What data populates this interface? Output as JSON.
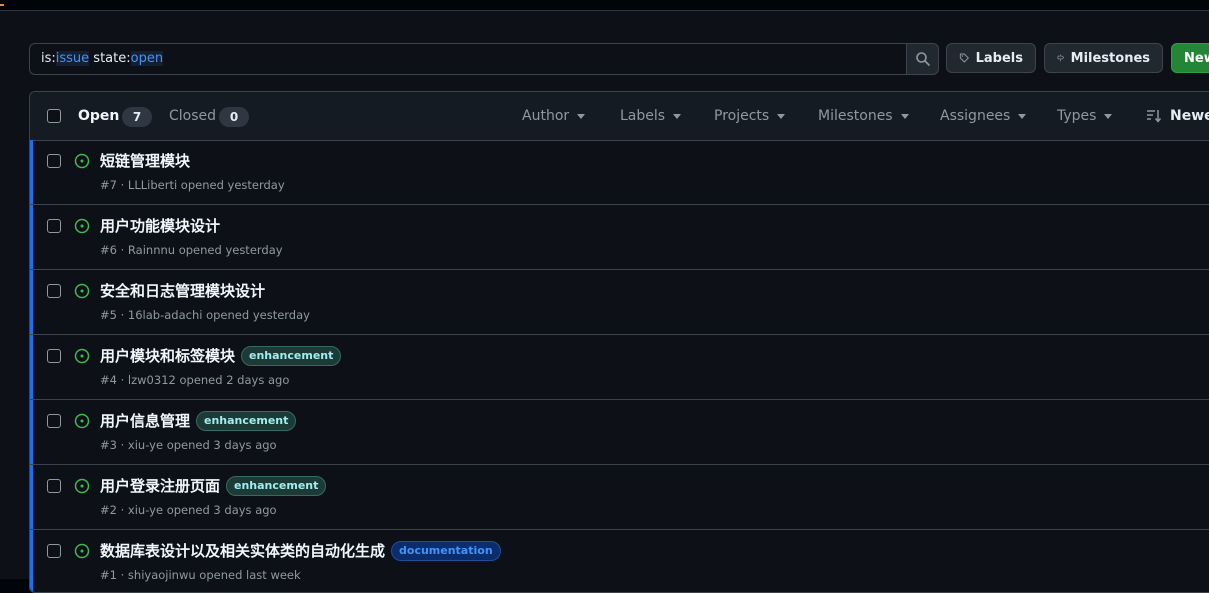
{
  "search": {
    "prefix_is": "is:",
    "value_is": "issue",
    "prefix_state": " state:",
    "value_state": "open"
  },
  "buttons": {
    "labels": "Labels",
    "milestones": "Milestones",
    "new": "New"
  },
  "tabs": {
    "open_label": "Open",
    "open_count": "7",
    "closed_label": "Closed",
    "closed_count": "0"
  },
  "filters": {
    "author": "Author",
    "labels": "Labels",
    "projects": "Projects",
    "milestones": "Milestones",
    "assignees": "Assignees",
    "types": "Types",
    "sort": "Newest"
  },
  "issues": [
    {
      "title": "短链管理模块",
      "label": "",
      "meta": "#7 · LLLiberti opened yesterday"
    },
    {
      "title": "用户功能模块设计",
      "label": "",
      "meta": "#6 · Rainnnu opened yesterday"
    },
    {
      "title": "安全和日志管理模块设计",
      "label": "",
      "meta": "#5 · 16lab-adachi opened yesterday"
    },
    {
      "title": "用户模块和标签模块",
      "label": "enhancement",
      "meta": "#4 · lzw0312 opened 2 days ago"
    },
    {
      "title": "用户信息管理",
      "label": "enhancement",
      "meta": "#3 · xiu-ye opened 3 days ago"
    },
    {
      "title": "用户登录注册页面",
      "label": "enhancement",
      "meta": "#2 · xiu-ye opened 3 days ago"
    },
    {
      "title": "数据库表设计以及相关实体类的自动化生成",
      "label": "documentation",
      "meta": "#1 · shiyaojinwu opened last week"
    }
  ],
  "colors": {
    "accent": "#1f6feb",
    "open_icon": "#3fb950",
    "new_button": "#238636"
  }
}
